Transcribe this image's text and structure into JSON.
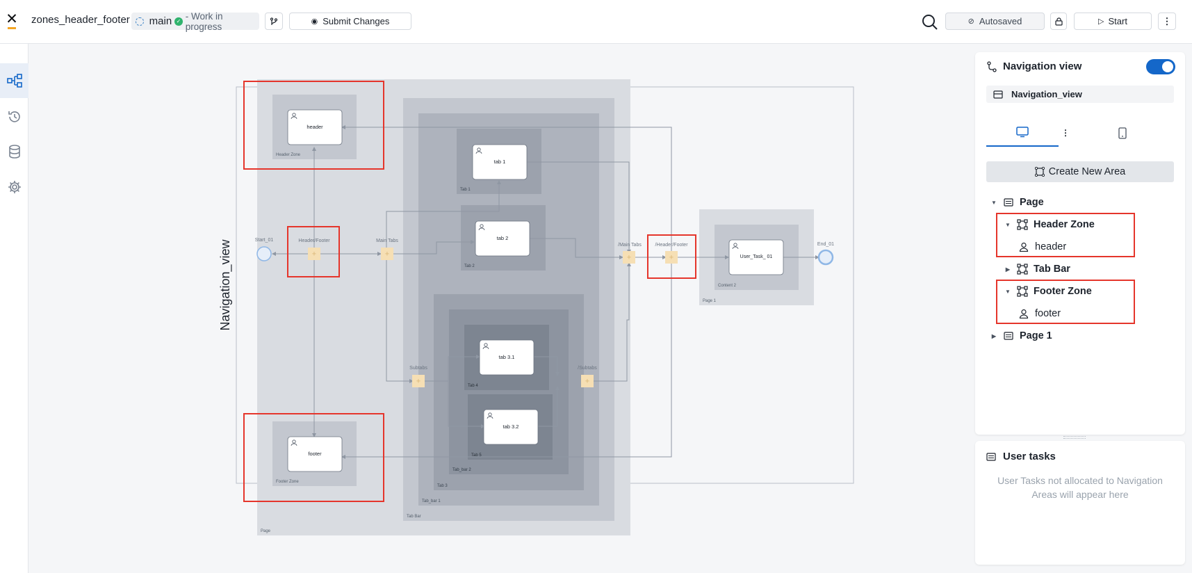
{
  "header": {
    "process_name": "zones_header_footer",
    "branch": "main",
    "branch_status": "- Work in progress",
    "submit_label": "Submit Changes",
    "autosaved_label": "Autosaved",
    "start_label": "Start"
  },
  "left_rail": {
    "items": [
      "process-diagram-icon",
      "history-icon",
      "database-icon",
      "settings-icon"
    ],
    "active": "process-diagram-icon"
  },
  "diagram": {
    "pool_label": "Navigation_view",
    "nodes": {
      "start": "Start_01",
      "end": "End_01",
      "gw_header_footer": "Header/Footer",
      "gw_main_tabs": "Main Tabs",
      "gw_subtabs": "Subtabs",
      "gw_subtabs_close": "/Subtabs",
      "gw_main_tabs_close": "/Main Tabs",
      "gw_header_footer_close": "/Header/Footer",
      "task_header": "header",
      "task_footer": "footer",
      "task_tab1": "tab 1",
      "task_tab2": "tab 2",
      "task_tab31": "tab 3.1",
      "task_tab32": "tab 3.2",
      "task_user": "User_Task_ 01"
    },
    "areas": {
      "page": "Page",
      "header_zone": "Header Zone",
      "footer_zone": "Footer Zone",
      "tab_bar": "Tab Bar",
      "tab_bar_1": "Tab_bar 1",
      "tab1": "Tab 1",
      "tab2": "Tab 2",
      "tab3": "Tab 3",
      "tab_bar_2": "Tab_bar 2",
      "tab4": "Tab 4",
      "tab5": "Tab 5",
      "page1": "Page 1",
      "content2": "Content 2"
    }
  },
  "panel": {
    "title": "Navigation view",
    "toggle_on": true,
    "view_name": "Navigation_view",
    "create_area_label": "Create New Area",
    "tree": {
      "page": "Page",
      "header_zone": "Header Zone",
      "header_task": "header",
      "tab_bar": "Tab Bar",
      "footer_zone": "Footer Zone",
      "footer_task": "footer",
      "page1": "Page 1"
    }
  },
  "user_tasks": {
    "title": "User tasks",
    "empty_note": "User Tasks not allocated to Navigation Areas will appear here"
  },
  "colors": {
    "accent": "#1467c9",
    "highlight": "#e5352b",
    "gateway": "#f6dfb4"
  }
}
